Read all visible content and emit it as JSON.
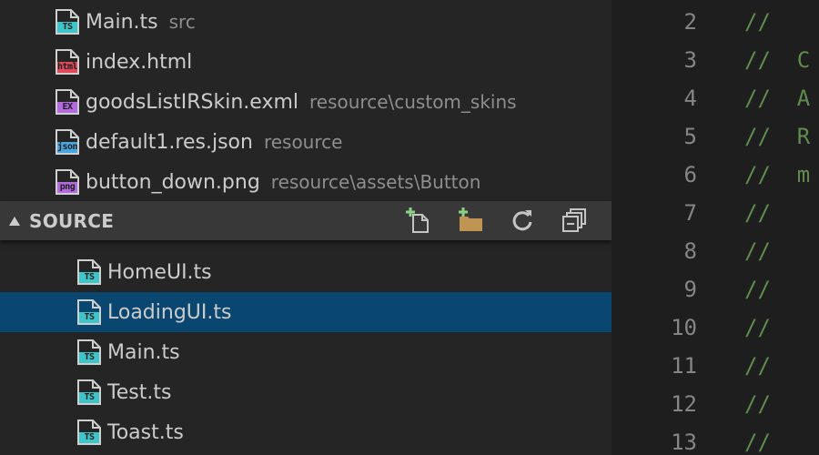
{
  "open_editors": [
    {
      "name": "Main.ts",
      "desc": "src",
      "icon": "ts-file-icon",
      "badge": "TS",
      "badge_color": "#3ec5c9"
    },
    {
      "name": "index.html",
      "desc": "",
      "icon": "html-file-icon",
      "badge": "html",
      "badge_color": "#e04a5a"
    },
    {
      "name": "goodsListIRSkin.exml",
      "desc": "resource\\custom_skins",
      "icon": "exml-file-icon",
      "badge": "EX",
      "badge_color": "#b36adf"
    },
    {
      "name": "default1.res.json",
      "desc": "resource",
      "icon": "json-file-icon",
      "badge": "json",
      "badge_color": "#4aa6e0"
    },
    {
      "name": "button_down.png",
      "desc": "resource\\assets\\Button",
      "icon": "png-file-icon",
      "badge": "png",
      "badge_color": "#b36adf"
    }
  ],
  "source_section": {
    "title": "SOURCE",
    "actions": [
      {
        "name": "new-file-icon"
      },
      {
        "name": "new-folder-icon"
      },
      {
        "name": "refresh-icon"
      },
      {
        "name": "collapse-all-icon"
      }
    ]
  },
  "source_files": [
    {
      "name": "HomeUI.ts",
      "selected": false
    },
    {
      "name": "LoadingUI.ts",
      "selected": true
    },
    {
      "name": "Main.ts",
      "selected": false
    },
    {
      "name": "Test.ts",
      "selected": false
    },
    {
      "name": "Toast.ts",
      "selected": false
    }
  ],
  "ts_badge": "TS",
  "editor_lines": [
    {
      "num": "2",
      "code": "//"
    },
    {
      "num": "3",
      "code": "//  C"
    },
    {
      "num": "4",
      "code": "//  A"
    },
    {
      "num": "5",
      "code": "//  R"
    },
    {
      "num": "6",
      "code": "//  m"
    },
    {
      "num": "7",
      "code": "//"
    },
    {
      "num": "8",
      "code": "//"
    },
    {
      "num": "9",
      "code": "//"
    },
    {
      "num": "10",
      "code": "//"
    },
    {
      "num": "11",
      "code": "//"
    },
    {
      "num": "12",
      "code": "//"
    },
    {
      "num": "13",
      "code": "//"
    }
  ],
  "colors": {
    "sidebar_bg": "#252526",
    "selection": "#094771",
    "header_bg": "#383838",
    "comment": "#608b4e",
    "line_number": "#858585"
  }
}
